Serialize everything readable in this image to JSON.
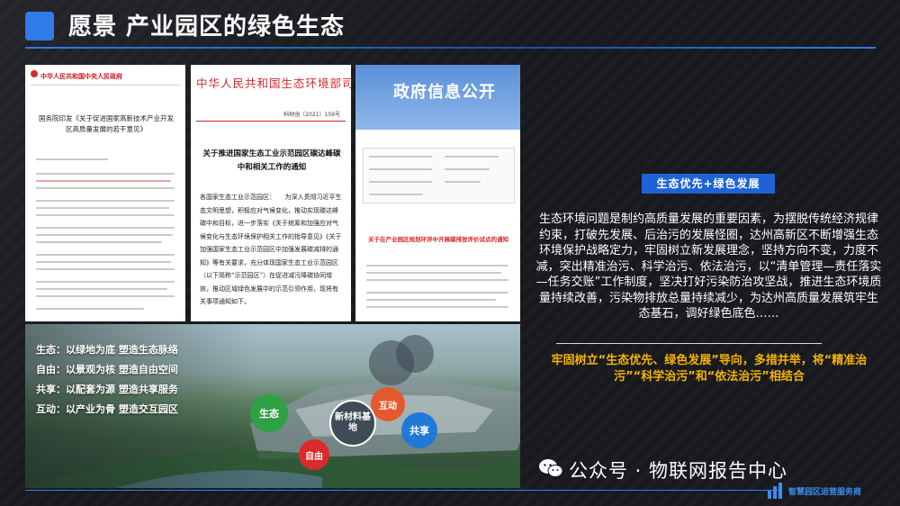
{
  "header": {
    "title": "愿景  产业园区的绿色生态"
  },
  "doc1": {
    "head": "中华人民共和国中央人民政府",
    "title": "国务院印发《关于促进国家高新技术产业开发区高质量发展的若干意见》"
  },
  "doc2": {
    "head": "中华人民共和国生态环境部司函",
    "num": "科财函〔2021〕159号",
    "title": "关于推进国家生态工业示范园区碳达峰碳中和相关工作的通知",
    "body": "各国家生态工业示范园区：　　为深入贯彻习近平生态文明思想，积极应对气候变化，推动实现碳达峰碳中和目标，进一步落实《关于统筹和加强应对气候变化与生态环境保护相关工作的指导意见》《关于加强国家生态工业示范园区中加强发展碳减排的通知》等有关要求，充分体现国家生态工业示范园区（以下简称“示范园区”）在促进减污降碳协同增效，推动区域绿色发展中的示范引领作用，现将有关事项通知如下。"
  },
  "doc3": {
    "banner": "政府信息公开",
    "red_title": "关于在产业园区规划环评中开展碳排放评价试点的通知"
  },
  "photo": {
    "rows": [
      "生态：以绿地为底  塑造生态脉络",
      "自由：以景观为核  塑造自由空间",
      "共享：以配套为源  塑造共享服务",
      "互动：以产业为骨  塑造交互园区"
    ],
    "bubbles": {
      "shengtai": "生态",
      "hudong": "互动",
      "xincailiao": "新材料基地",
      "gongxiang": "共享",
      "ziyou": "自由"
    }
  },
  "right": {
    "tag": "生态优先+绿色发展",
    "body": "生态环境问题是制约高质量发展的重要因素，为摆脱传统经济规律约束，打破先发展、后治污的发展怪圈，达州高新区不断增强生态环境保护战略定力，牢固树立新发展理念，坚持方向不变，力度不减，突出精准治污、科学治污、依法治污，以“清单管理—责任落实—任务交账”工作制度，坚决打好污染防治攻坚战，推进生态环境质量持续改善，污染物排放总量持续减少，为达州高质量发展筑牢生态基石，调好绿色底色……",
    "highlight": "牢固树立“生态优先、绿色发展”导向，多措并举，将“精准治污”“科学治污”和“依法治污”相结合"
  },
  "footer": {
    "wechat_text": "公众号 · 物联网报告中心",
    "logo_text": "智慧园区运营服务商"
  },
  "colors": {
    "accent": "#2f7be8",
    "highlight": "#f5b400",
    "tag_bg": "#1e63d6"
  }
}
